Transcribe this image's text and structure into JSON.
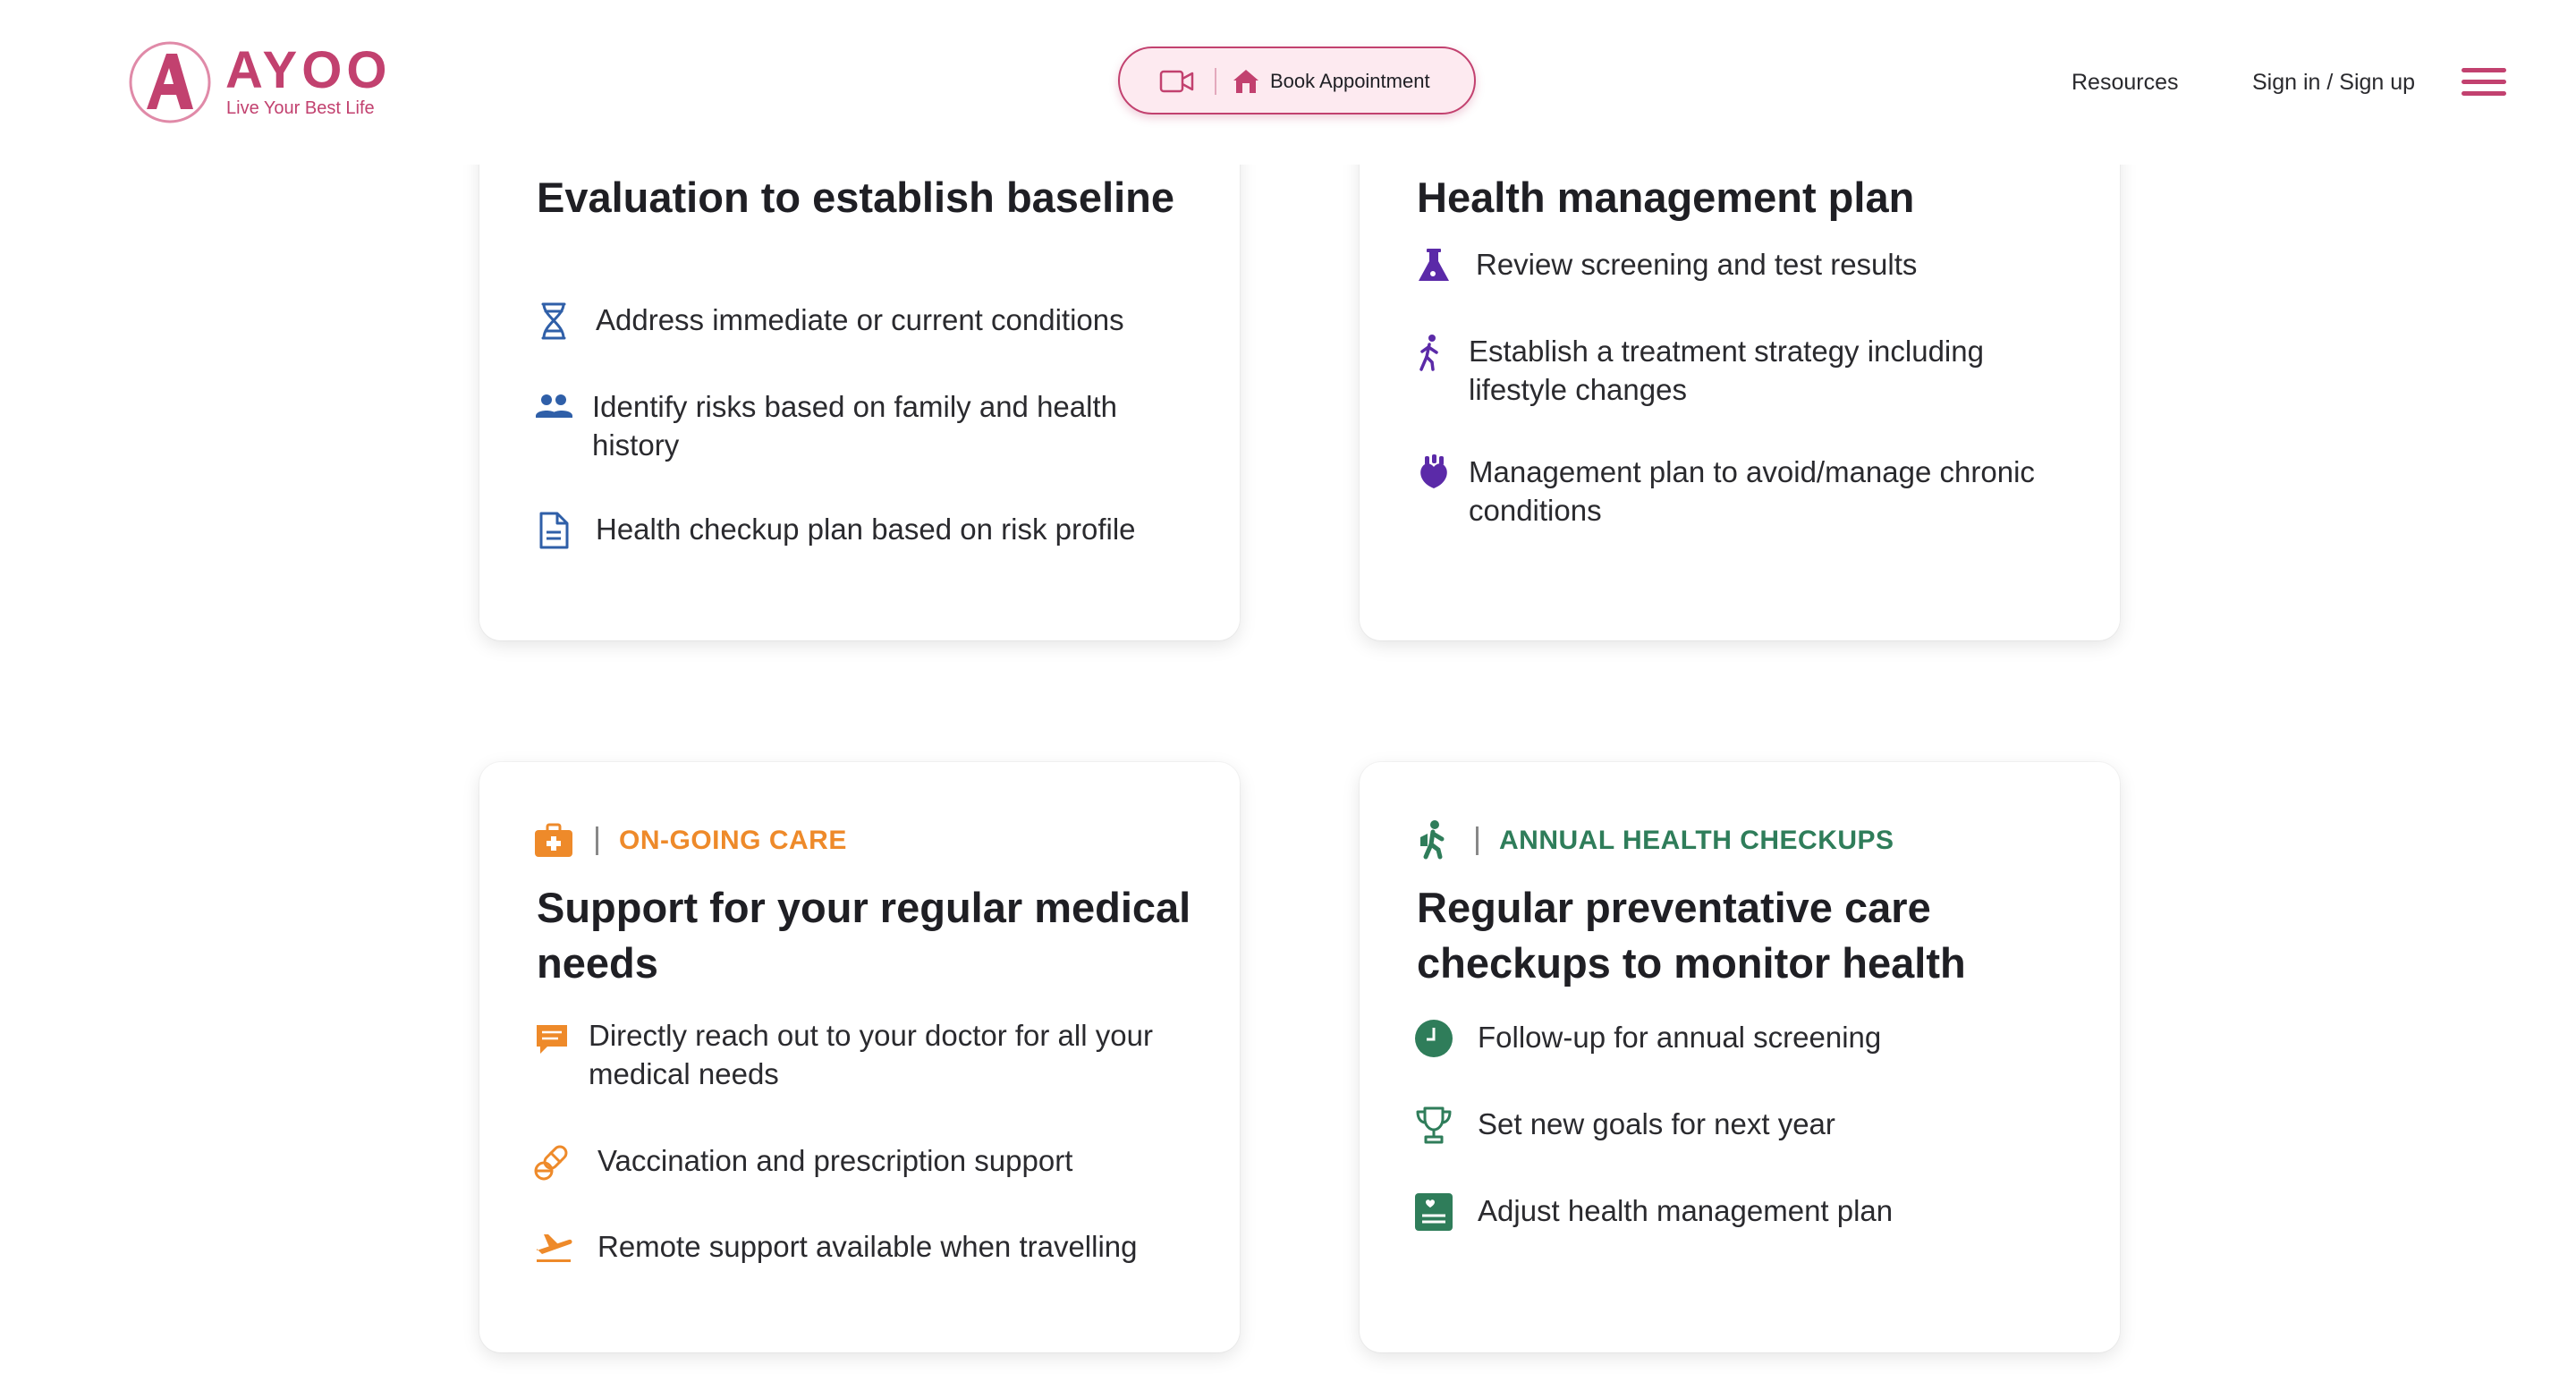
{
  "header": {
    "logo_name": "AYOO",
    "logo_tagline": "Live Your Best Life",
    "book_label": "Book Appointment",
    "nav": {
      "resources": "Resources",
      "sign_in": "Sign in / Sign up"
    },
    "brand_color": "#c2416f"
  },
  "cards": [
    {
      "title": "Evaluation to establish baseline",
      "accent": "#2f5fa8",
      "items": [
        {
          "icon": "dna-icon",
          "text": "Address immediate or current conditions"
        },
        {
          "icon": "people-icon",
          "text": "Identify risks based on family and health history"
        },
        {
          "icon": "document-icon",
          "text": "Health checkup plan based on risk profile"
        }
      ]
    },
    {
      "title": "Health management plan",
      "accent": "#5b2aa8",
      "items": [
        {
          "icon": "flask-icon",
          "text": "Review screening and test results"
        },
        {
          "icon": "walking-person-icon",
          "text": "Establish a treatment strategy including lifestyle changes"
        },
        {
          "icon": "heart-organ-icon",
          "text": "Management plan to avoid/manage chronic conditions"
        }
      ]
    },
    {
      "category": "ON-GOING CARE",
      "category_icon": "medical-kit-icon",
      "title": "Support for your regular medical needs",
      "accent": "#ee8a2a",
      "items": [
        {
          "icon": "chat-icon",
          "text": "Directly reach out to your doctor for all your medical needs"
        },
        {
          "icon": "pills-icon",
          "text": "Vaccination and prescription support"
        },
        {
          "icon": "airplane-icon",
          "text": "Remote support available when travelling"
        }
      ]
    },
    {
      "category": "ANNUAL HEALTH CHECKUPS",
      "category_icon": "hiking-person-icon",
      "title": "Regular preventative care checkups to monitor health",
      "accent": "#2f7d5a",
      "items": [
        {
          "icon": "clock-icon",
          "text": "Follow-up for annual screening"
        },
        {
          "icon": "trophy-icon",
          "text": "Set new goals for next year"
        },
        {
          "icon": "health-record-icon",
          "text": "Adjust health management plan"
        }
      ]
    }
  ]
}
